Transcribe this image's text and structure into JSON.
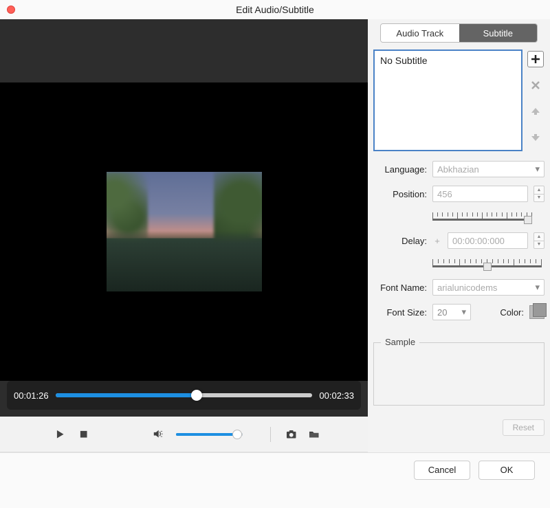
{
  "window": {
    "title": "Edit Audio/Subtitle"
  },
  "tabs": {
    "audio_track": "Audio Track",
    "subtitle": "Subtitle"
  },
  "subtitle_list": {
    "item0": "No Subtitle"
  },
  "labels": {
    "language": "Language:",
    "position": "Position:",
    "delay": "Delay:",
    "font_name": "Font Name:",
    "font_size": "Font Size:",
    "color": "Color:",
    "sample": "Sample"
  },
  "fields": {
    "language": "Abkhazian",
    "position": "456",
    "delay_prefix": "+",
    "delay": "00:00:00:000",
    "font_name": "arialunicodems",
    "font_size": "20"
  },
  "player": {
    "current_time": "00:01:26",
    "total_time": "00:02:33"
  },
  "buttons": {
    "reset": "Reset",
    "cancel": "Cancel",
    "ok": "OK"
  }
}
